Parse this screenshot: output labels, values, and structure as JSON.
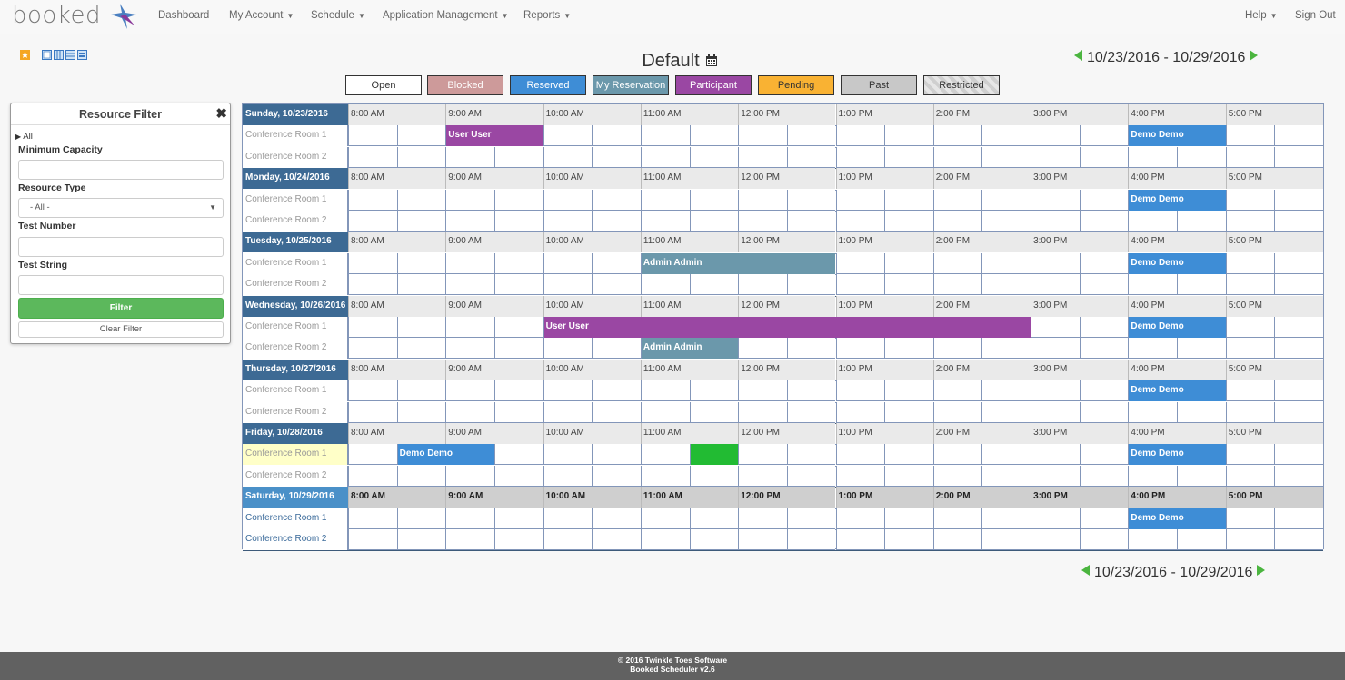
{
  "brand": {
    "logo_text": "booked",
    "colors": {
      "accent": "#3d6a94",
      "green": "#5cb85c"
    }
  },
  "nav": {
    "dashboard": "Dashboard",
    "my_account": "My Account",
    "schedule": "Schedule",
    "app_mgmt": "Application Management",
    "reports": "Reports",
    "help": "Help",
    "sign_out": "Sign Out"
  },
  "schedule": {
    "title": "Default",
    "date_range": "10/23/2016 - 10/29/2016"
  },
  "legend": [
    {
      "label": "Open",
      "color": "#ffffff",
      "text": "#333333"
    },
    {
      "label": "Blocked",
      "color": "#cd9a9a",
      "text": "#ffffff"
    },
    {
      "label": "Reserved",
      "color": "#3e8dd6",
      "text": "#ffffff"
    },
    {
      "label": "My Reservation",
      "color": "#6b98ab",
      "text": "#ffffff"
    },
    {
      "label": "Participant",
      "color": "#9a47a3",
      "text": "#ffffff"
    },
    {
      "label": "Pending",
      "color": "#f9b233",
      "text": "#333333"
    },
    {
      "label": "Past",
      "color": "#c8c8c8",
      "text": "#333333"
    },
    {
      "label": "Restricted",
      "color": "#cfcfcf",
      "text": "#333333"
    }
  ],
  "filter": {
    "title": "Resource Filter",
    "all_label": "All",
    "min_capacity_label": "Minimum Capacity",
    "min_capacity_value": "",
    "resource_type_label": "Resource Type",
    "resource_type_value": "- All -",
    "test_number_label": "Test Number",
    "test_number_value": "",
    "test_string_label": "Test String",
    "test_string_value": "",
    "filter_button": "Filter",
    "clear_button": "Clear Filter"
  },
  "times": [
    "8:00 AM",
    "9:00 AM",
    "10:00 AM",
    "11:00 AM",
    "12:00 PM",
    "1:00 PM",
    "2:00 PM",
    "3:00 PM",
    "4:00 PM",
    "5:00 PM"
  ],
  "resources": [
    "Conference Room 1",
    "Conference Room 2"
  ],
  "days": [
    {
      "label": "Sunday, 10/23/2016",
      "today": false,
      "reservations": [
        {
          "room": 0,
          "start": "9:00 AM",
          "end": "10:00 AM",
          "label": "User User",
          "kind": "participant"
        },
        {
          "room": 0,
          "start": "4:00 PM",
          "end": "5:00 PM",
          "label": "Demo Demo",
          "kind": "reserved"
        }
      ]
    },
    {
      "label": "Monday, 10/24/2016",
      "today": false,
      "reservations": [
        {
          "room": 0,
          "start": "4:00 PM",
          "end": "5:00 PM",
          "label": "Demo Demo",
          "kind": "reserved"
        }
      ]
    },
    {
      "label": "Tuesday, 10/25/2016",
      "today": false,
      "reservations": [
        {
          "room": 0,
          "start": "11:00 AM",
          "end": "1:00 PM",
          "label": "Admin Admin",
          "kind": "mine"
        },
        {
          "room": 0,
          "start": "4:00 PM",
          "end": "5:00 PM",
          "label": "Demo Demo",
          "kind": "reserved"
        }
      ]
    },
    {
      "label": "Wednesday, 10/26/2016",
      "today": false,
      "reservations": [
        {
          "room": 0,
          "start": "10:00 AM",
          "end": "3:00 PM",
          "label": "User User",
          "kind": "participant"
        },
        {
          "room": 0,
          "start": "4:00 PM",
          "end": "5:00 PM",
          "label": "Demo Demo",
          "kind": "reserved"
        },
        {
          "room": 1,
          "start": "11:00 AM",
          "end": "12:00 PM",
          "label": "Admin Admin",
          "kind": "mine"
        }
      ]
    },
    {
      "label": "Thursday, 10/27/2016",
      "today": false,
      "reservations": [
        {
          "room": 0,
          "start": "4:00 PM",
          "end": "5:00 PM",
          "label": "Demo Demo",
          "kind": "reserved"
        }
      ]
    },
    {
      "label": "Friday, 10/28/2016",
      "today": false,
      "highlight_room": 0,
      "reservations": [
        {
          "room": 0,
          "start": "8:30 AM",
          "end": "9:30 AM",
          "label": "Demo Demo",
          "kind": "reserved"
        },
        {
          "room": 0,
          "start": "11:30 AM",
          "end": "12:00 PM",
          "label": "",
          "kind": "selected"
        },
        {
          "room": 0,
          "start": "4:00 PM",
          "end": "5:00 PM",
          "label": "Demo Demo",
          "kind": "reserved"
        }
      ]
    },
    {
      "label": "Saturday, 10/29/2016",
      "today": true,
      "reservations": [
        {
          "room": 0,
          "start": "4:00 PM",
          "end": "5:00 PM",
          "label": "Demo Demo",
          "kind": "reserved"
        }
      ]
    }
  ],
  "reservation_colors": {
    "participant": "#9a47a3",
    "reserved": "#3e8dd6",
    "mine": "#6b98ab",
    "selected": "#22bb33"
  },
  "footer": {
    "line1": "© 2016 Twinkle Toes Software",
    "line2": "Booked Scheduler v2.6"
  }
}
